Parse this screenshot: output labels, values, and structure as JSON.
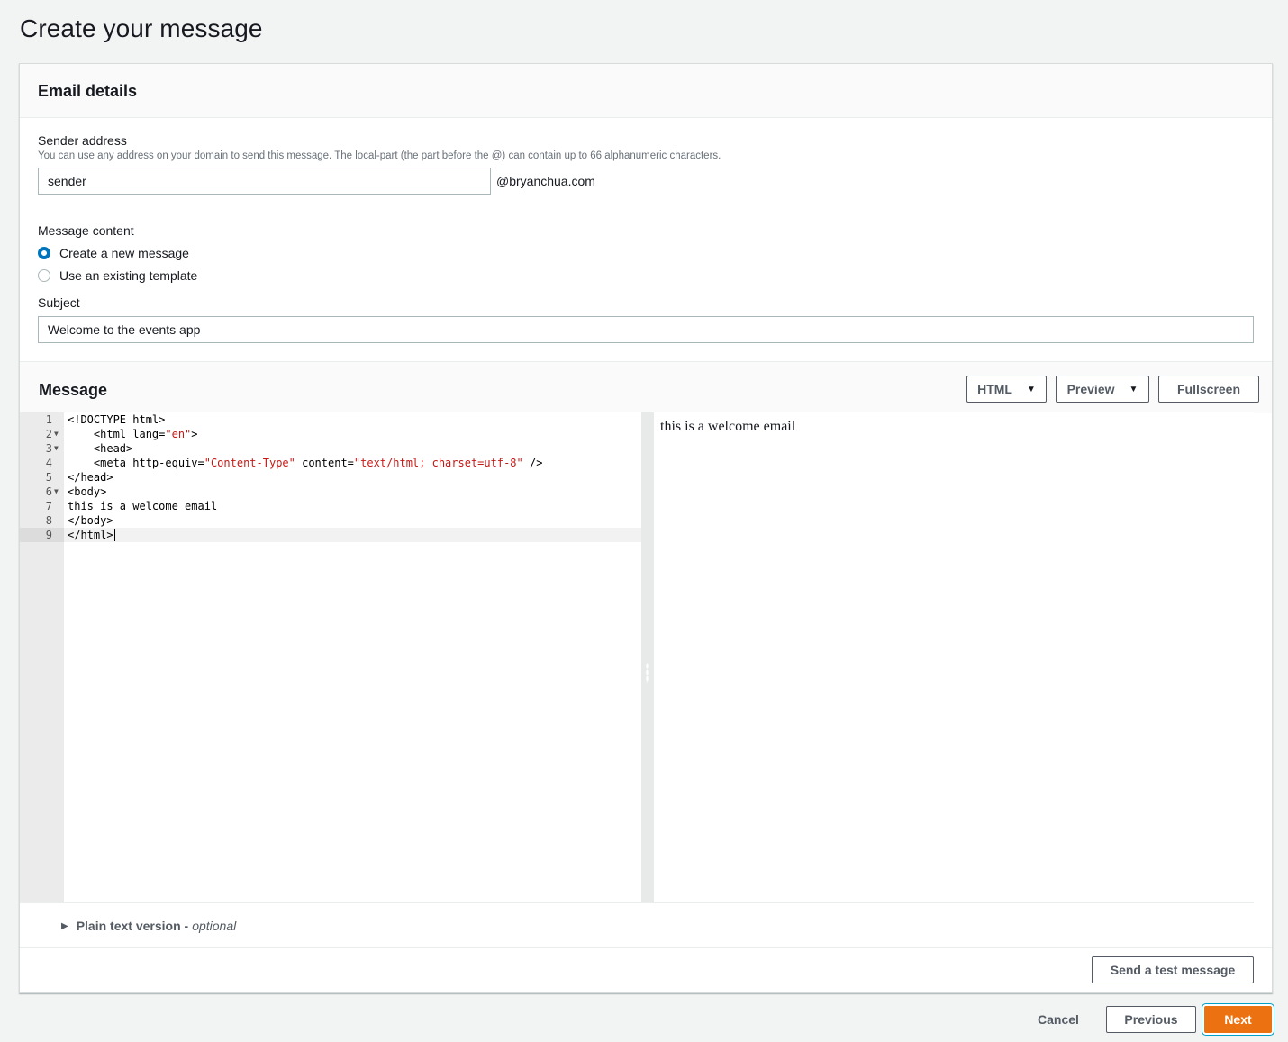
{
  "page": {
    "title": "Create your message"
  },
  "email_details": {
    "header": "Email details",
    "sender_label": "Sender address",
    "sender_hint": "You can use any address on your domain to send this message. The local-part (the part before the @) can contain up to 66 alphanumeric characters.",
    "sender_value": "sender",
    "domain_suffix": "@bryanchua.com",
    "content_label": "Message content",
    "options": [
      {
        "label": "Create a new message",
        "checked": true
      },
      {
        "label": "Use an existing template",
        "checked": false
      }
    ],
    "subject_label": "Subject",
    "subject_value": "Welcome to the events app"
  },
  "message": {
    "header": "Message",
    "format_select": "HTML",
    "view_select": "Preview",
    "fullscreen_label": "Fullscreen",
    "code_lines": [
      {
        "num": "1",
        "fold": false,
        "parts": [
          [
            "t",
            "<!DOCTYPE html>"
          ]
        ]
      },
      {
        "num": "2",
        "fold": true,
        "parts": [
          [
            "t",
            "    <html lang="
          ],
          [
            "s",
            "\"en\""
          ],
          [
            "t",
            ">"
          ]
        ]
      },
      {
        "num": "3",
        "fold": true,
        "parts": [
          [
            "t",
            "    <head>"
          ]
        ]
      },
      {
        "num": "4",
        "fold": false,
        "parts": [
          [
            "t",
            "    <meta http-equiv="
          ],
          [
            "s",
            "\"Content-Type\""
          ],
          [
            "t",
            " content="
          ],
          [
            "s",
            "\"text/html; charset=utf-8\""
          ],
          [
            "t",
            " />"
          ]
        ]
      },
      {
        "num": "5",
        "fold": false,
        "parts": [
          [
            "t",
            "</head>"
          ]
        ]
      },
      {
        "num": "6",
        "fold": true,
        "parts": [
          [
            "t",
            "<body>"
          ]
        ]
      },
      {
        "num": "7",
        "fold": false,
        "parts": [
          [
            "t",
            "this is a welcome email"
          ]
        ]
      },
      {
        "num": "8",
        "fold": false,
        "parts": [
          [
            "t",
            "</body>"
          ]
        ]
      },
      {
        "num": "9",
        "fold": false,
        "active": true,
        "parts": [
          [
            "t",
            "</html>"
          ]
        ]
      }
    ],
    "preview_text": "this is a welcome email",
    "plain_text_label": "Plain text version -",
    "plain_text_optional": "optional",
    "test_message_label": "Send a test message"
  },
  "footer": {
    "cancel_label": "Cancel",
    "previous_label": "Previous",
    "next_label": "Next"
  },
  "colors": {
    "primary": "#ec7211",
    "radio_selected": "#0073bb",
    "string_token": "#c41a16"
  },
  "icons": {
    "dropdown": "caret-down-icon",
    "expand": "caret-right-icon",
    "splitter": "drag-handle-icon"
  }
}
